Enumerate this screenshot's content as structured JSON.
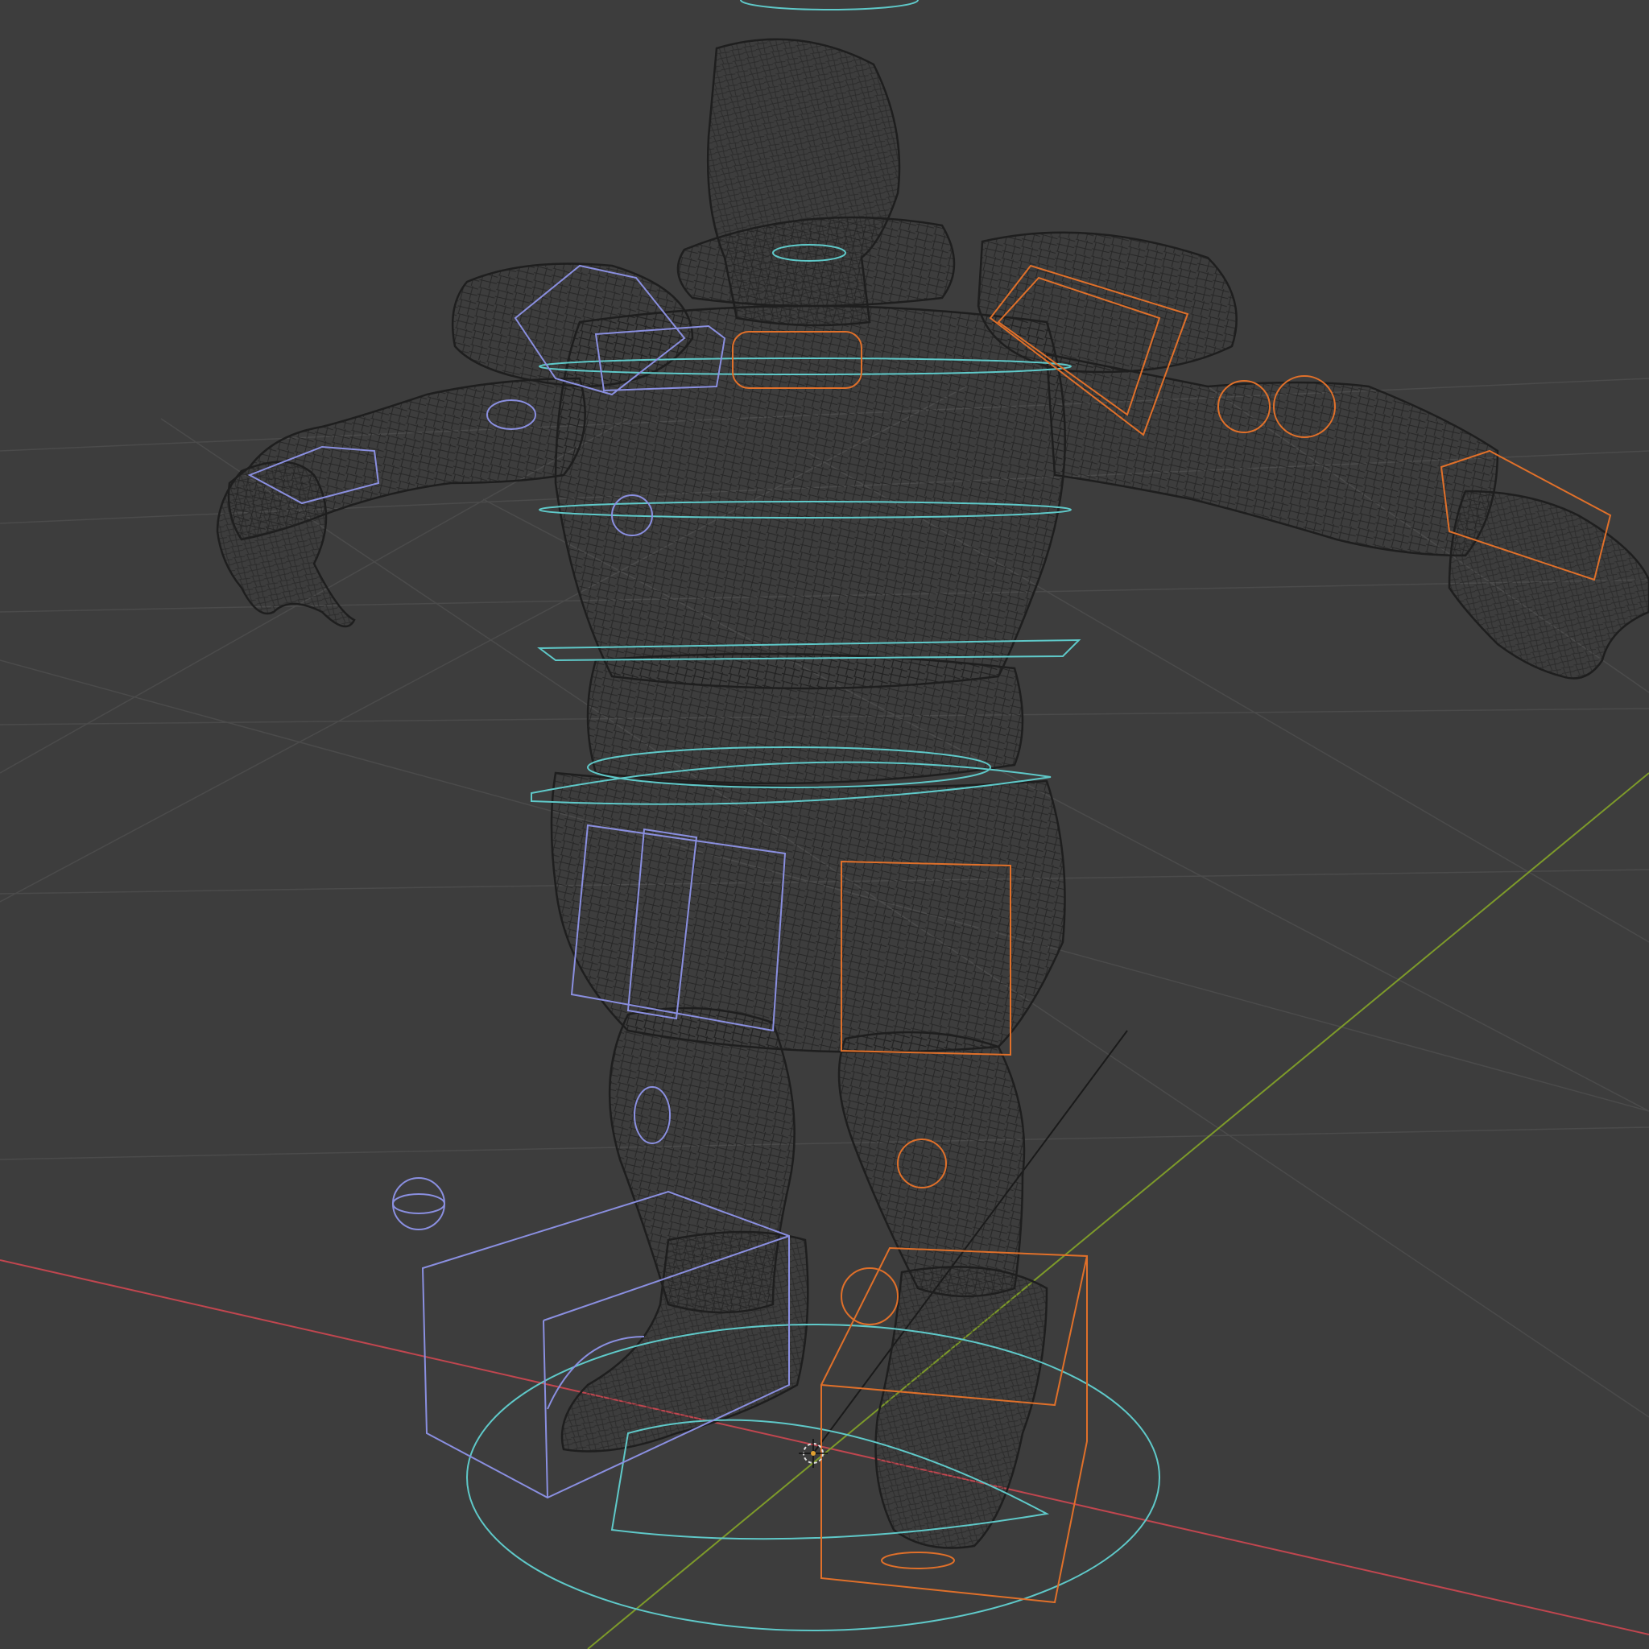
{
  "viewport": {
    "mode": "wireframe",
    "background_color": "#3d3d3d",
    "grid_color": "#4a4a4a"
  },
  "axes": {
    "x_axis_color": "#c0464f",
    "y_axis_color": "#7d9a2a"
  },
  "scene": {
    "mesh_name": "character-mesh",
    "mesh_wire_color": "#1e1e1e",
    "rig_center_color": "#5fc9c9",
    "rig_left_color": "#8a8fe0",
    "rig_right_color": "#e0702a"
  }
}
